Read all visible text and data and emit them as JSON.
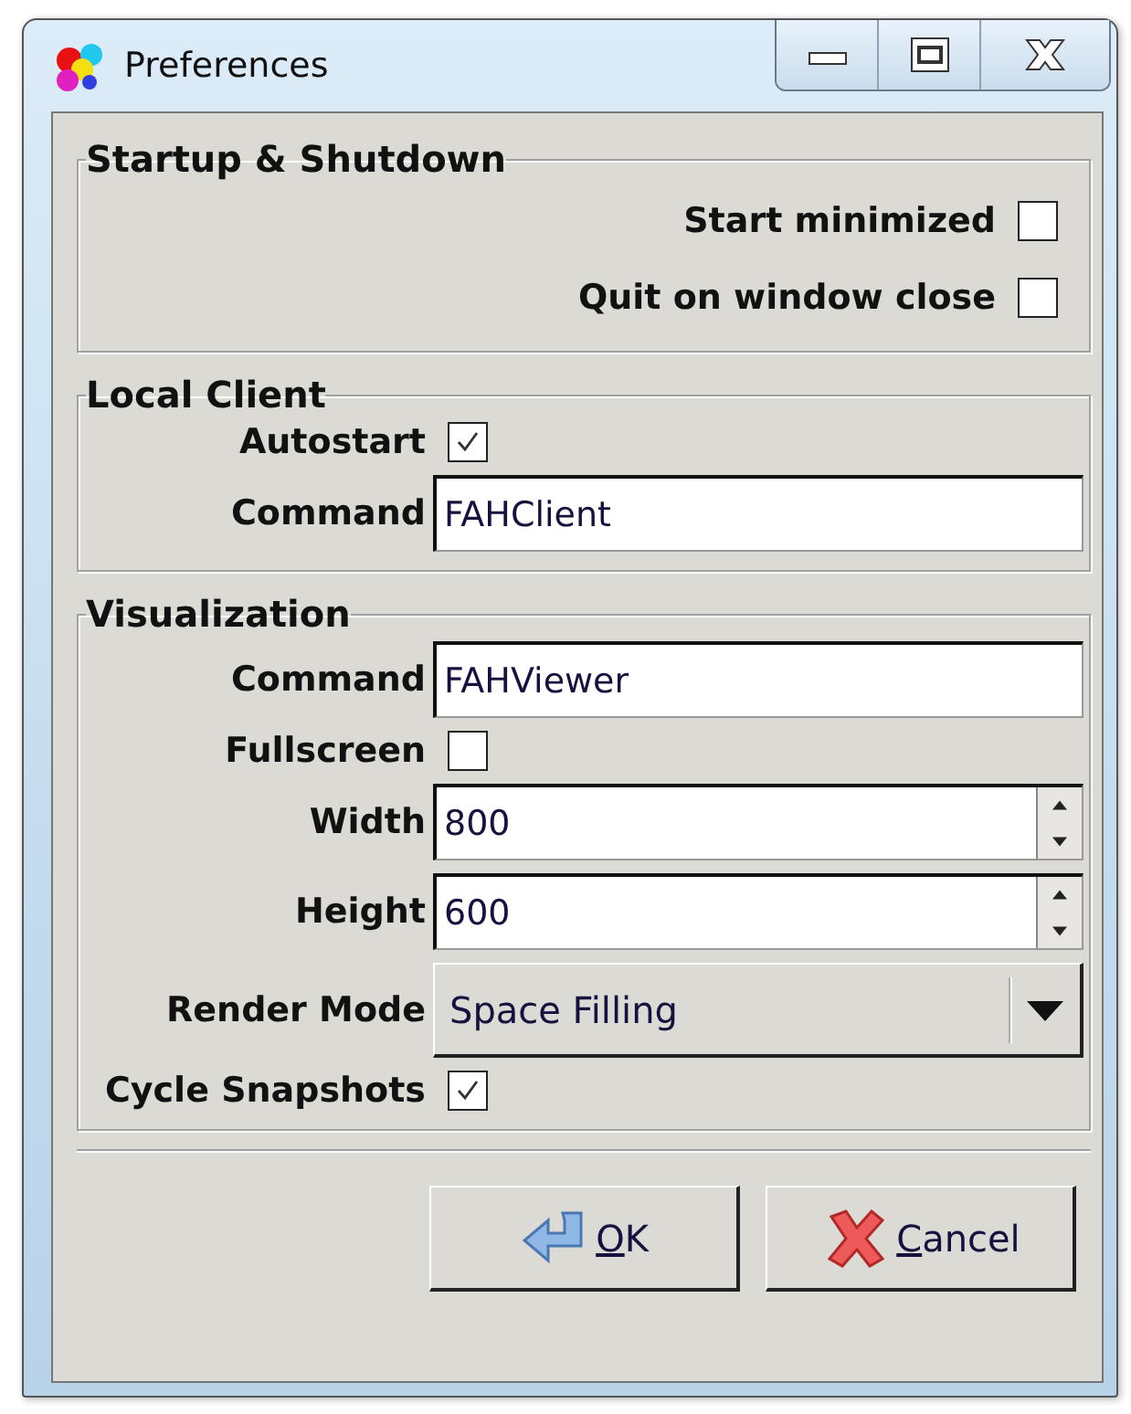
{
  "window": {
    "title": "Preferences"
  },
  "groups": [
    {
      "title": "Startup & Shutdown",
      "rows": [
        {
          "label": "Start minimized",
          "kind": "checkbox",
          "checked": false
        },
        {
          "label": "Quit on window close",
          "kind": "checkbox",
          "checked": false
        }
      ]
    },
    {
      "title": "Local Client",
      "rows": [
        {
          "label": "Autostart",
          "kind": "checkbox",
          "checked": true
        },
        {
          "label": "Command",
          "kind": "text",
          "value": "FAHClient"
        }
      ]
    },
    {
      "title": "Visualization",
      "rows": [
        {
          "label": "Command",
          "kind": "text",
          "value": "FAHViewer"
        },
        {
          "label": "Fullscreen",
          "kind": "checkbox",
          "checked": false
        },
        {
          "label": "Width",
          "kind": "spin",
          "value": "800"
        },
        {
          "label": "Height",
          "kind": "spin",
          "value": "600"
        },
        {
          "label": "Render Mode",
          "kind": "select",
          "value": "Space Filling"
        },
        {
          "label": "Cycle Snapshots",
          "kind": "checkbox",
          "checked": true
        }
      ]
    }
  ],
  "buttons": [
    {
      "label": "OK",
      "kind": "ok"
    },
    {
      "label": "Cancel",
      "kind": "cancel"
    }
  ]
}
